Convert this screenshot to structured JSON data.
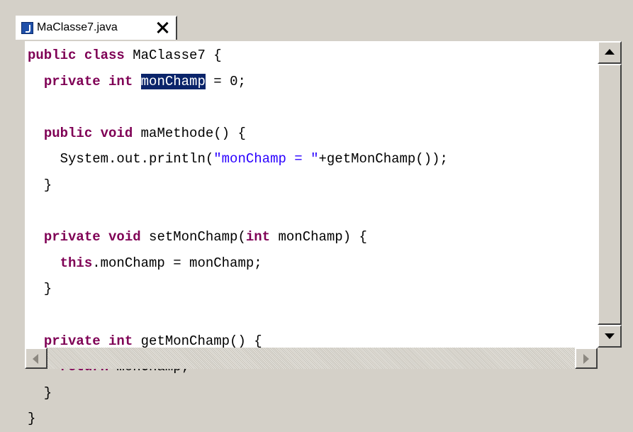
{
  "tab": {
    "icon": "java-file-icon",
    "label": "MaClasse7.java",
    "close_icon": "close-icon"
  },
  "code": {
    "lines": [
      {
        "segments": [
          {
            "t": "public class",
            "c": "kw"
          },
          {
            "t": " MaClasse7 {",
            "c": ""
          }
        ]
      },
      {
        "segments": [
          {
            "t": "  ",
            "c": ""
          },
          {
            "t": "private int",
            "c": "kw"
          },
          {
            "t": " ",
            "c": ""
          },
          {
            "t": "monChamp",
            "c": "sel"
          },
          {
            "t": " = 0;",
            "c": ""
          }
        ]
      },
      {
        "segments": [
          {
            "t": "",
            "c": ""
          }
        ]
      },
      {
        "segments": [
          {
            "t": "  ",
            "c": ""
          },
          {
            "t": "public void",
            "c": "kw"
          },
          {
            "t": " maMethode() {",
            "c": ""
          }
        ]
      },
      {
        "segments": [
          {
            "t": "    System.out.println(",
            "c": ""
          },
          {
            "t": "\"monChamp = \"",
            "c": "str"
          },
          {
            "t": "+getMonChamp());",
            "c": ""
          }
        ]
      },
      {
        "segments": [
          {
            "t": "  }",
            "c": ""
          }
        ]
      },
      {
        "segments": [
          {
            "t": "",
            "c": ""
          }
        ]
      },
      {
        "segments": [
          {
            "t": "  ",
            "c": ""
          },
          {
            "t": "private void",
            "c": "kw"
          },
          {
            "t": " setMonChamp(",
            "c": ""
          },
          {
            "t": "int",
            "c": "kw"
          },
          {
            "t": " monChamp) {",
            "c": ""
          }
        ]
      },
      {
        "segments": [
          {
            "t": "    ",
            "c": ""
          },
          {
            "t": "this",
            "c": "kw"
          },
          {
            "t": ".monChamp = monChamp;",
            "c": ""
          }
        ]
      },
      {
        "segments": [
          {
            "t": "  }",
            "c": ""
          }
        ]
      },
      {
        "segments": [
          {
            "t": "",
            "c": ""
          }
        ]
      },
      {
        "segments": [
          {
            "t": "  ",
            "c": ""
          },
          {
            "t": "private int",
            "c": "kw"
          },
          {
            "t": " getMonChamp() {",
            "c": ""
          }
        ]
      },
      {
        "segments": [
          {
            "t": "    ",
            "c": ""
          },
          {
            "t": "return",
            "c": "kw"
          },
          {
            "t": " monChamp;",
            "c": ""
          }
        ]
      },
      {
        "segments": [
          {
            "t": "  }",
            "c": ""
          }
        ]
      },
      {
        "segments": [
          {
            "t": "}",
            "c": ""
          }
        ]
      }
    ],
    "selected_text": "monChamp"
  },
  "scrollbars": {
    "vertical": {
      "up_icon": "arrow-up-icon",
      "down_icon": "arrow-down-icon"
    },
    "horizontal": {
      "left_icon": "arrow-left-icon",
      "right_icon": "arrow-right-icon"
    }
  },
  "colors": {
    "keyword": "#7f0055",
    "string": "#2a00ff",
    "selection_bg": "#0a246a",
    "selection_fg": "#ffffff",
    "chrome": "#d4d0c8"
  }
}
